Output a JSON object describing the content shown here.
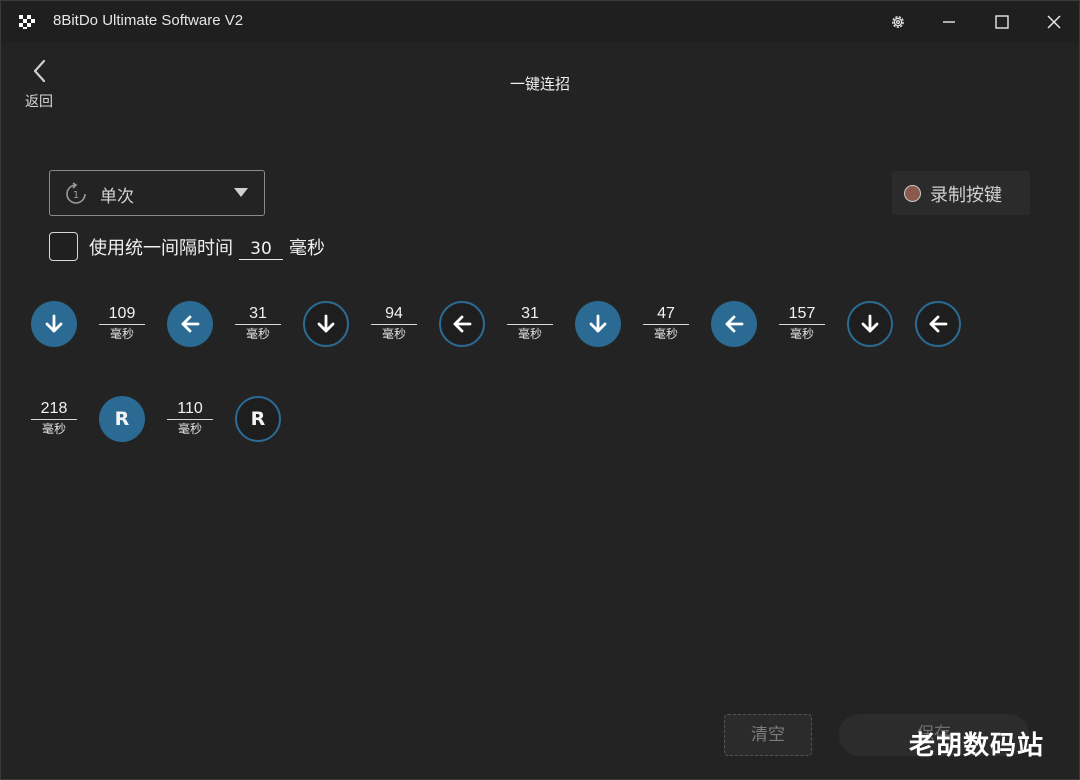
{
  "window": {
    "title": "8BitDo Ultimate Software V2",
    "icons": [
      "settings-gear-icon",
      "minimize-icon",
      "maximize-icon",
      "close-icon"
    ]
  },
  "nav": {
    "back_label": "返回",
    "back_icon": "chevron-left-icon"
  },
  "page": {
    "title": "一键连招"
  },
  "mode": {
    "icon": "repeat-once-icon",
    "value": "单次",
    "caret_icon": "triangle-down-icon"
  },
  "record": {
    "label": "录制按键",
    "dot_color": "#8a5a4c"
  },
  "interval": {
    "checked": false,
    "label": "使用统一间隔时间",
    "value": "30",
    "unit": "毫秒"
  },
  "sequence": {
    "unit": "毫秒",
    "accent": "#2a6a93",
    "steps": [
      {
        "kind": "button",
        "icon": "arrow-down-icon",
        "state": "pressed"
      },
      {
        "kind": "delay",
        "ms": "109"
      },
      {
        "kind": "button",
        "icon": "arrow-left-icon",
        "state": "pressed"
      },
      {
        "kind": "delay",
        "ms": "31"
      },
      {
        "kind": "button",
        "icon": "arrow-down-icon",
        "state": "released"
      },
      {
        "kind": "delay",
        "ms": "94"
      },
      {
        "kind": "button",
        "icon": "arrow-left-icon",
        "state": "released"
      },
      {
        "kind": "delay",
        "ms": "31"
      },
      {
        "kind": "button",
        "icon": "arrow-down-icon",
        "state": "pressed"
      },
      {
        "kind": "delay",
        "ms": "47"
      },
      {
        "kind": "button",
        "icon": "arrow-left-icon",
        "state": "pressed"
      },
      {
        "kind": "delay",
        "ms": "157"
      },
      {
        "kind": "button",
        "icon": "arrow-down-icon",
        "state": "released"
      },
      {
        "kind": "button",
        "icon": "arrow-left-icon",
        "state": "released"
      },
      {
        "kind": "delay",
        "ms": "218"
      },
      {
        "kind": "button",
        "icon": "r-button-icon",
        "letter": "R",
        "state": "pressed"
      },
      {
        "kind": "delay",
        "ms": "110"
      },
      {
        "kind": "button",
        "icon": "r-button-icon",
        "letter": "R",
        "state": "released"
      }
    ]
  },
  "actions": {
    "clear_label": "清空",
    "save_label": "保存"
  },
  "watermark": {
    "text": "老胡数码站"
  }
}
